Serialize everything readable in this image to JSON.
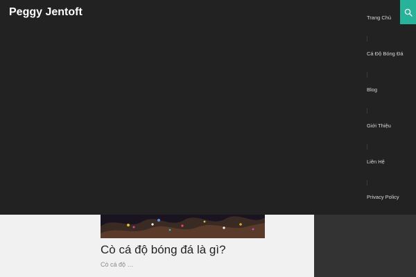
{
  "site": {
    "title": "Peggy Jentoft"
  },
  "nav": {
    "items": [
      {
        "label": "Trang Chủ"
      },
      {
        "label": "Cá Độ Bóng Đá"
      },
      {
        "label": "Blog"
      },
      {
        "label": "Giới Thiệu"
      },
      {
        "label": "Liên Hệ"
      },
      {
        "label": "Privacy Policy"
      }
    ]
  },
  "search": {
    "icon": "search-icon"
  },
  "post": {
    "title": "Cò cá độ bóng đá là gì?",
    "excerpt": "Cò cá độ …"
  },
  "colors": {
    "header_bg": "#222222",
    "accent": "#27b399",
    "page_bg": "#f1f1f1",
    "sidebar_bg": "#333333"
  }
}
